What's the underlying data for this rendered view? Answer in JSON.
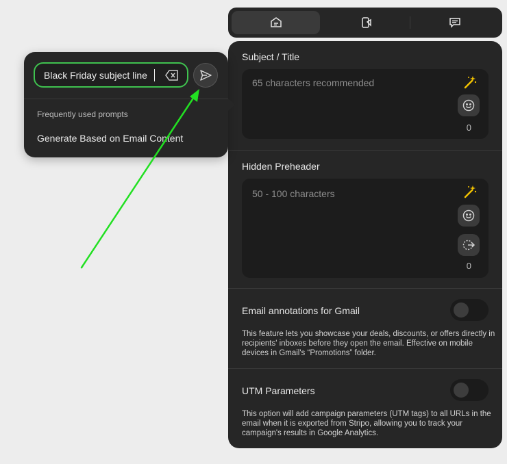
{
  "tabs": [
    {
      "icon": "email-settings-icon",
      "active": true
    },
    {
      "icon": "phone-design-icon",
      "active": false
    },
    {
      "icon": "chat-comment-icon",
      "active": false
    }
  ],
  "subject": {
    "title": "Subject / Title",
    "placeholder": "65 characters recommended",
    "count": "0"
  },
  "preheader": {
    "title": "Hidden Preheader",
    "placeholder": "50 - 100 characters",
    "count": "0"
  },
  "gmail": {
    "title": "Email annotations for Gmail",
    "enabled": false,
    "description": "This feature lets you showcase your deals, discounts, or offers directly in recipients' inboxes before they open the email. Effective on mobile devices in Gmail's “Promotions” folder."
  },
  "utm": {
    "title": "UTM Parameters",
    "enabled": false,
    "description": "This option will add campaign parameters (UTM tags) to all URLs in the email when it is exported from Stripo, allowing you to track your campaign's results in Google Analytics."
  },
  "popup": {
    "input_value": "Black Friday subject line",
    "frequent_label": "Frequently used prompts",
    "frequent_items": [
      "Generate Based on Email Content"
    ]
  },
  "colors": {
    "accent_green": "#3fc24f",
    "wand_yellow": "#f2c200",
    "annotation_arrow": "#22e022",
    "panel_bg": "#262626",
    "field_bg": "#1c1c1c"
  }
}
